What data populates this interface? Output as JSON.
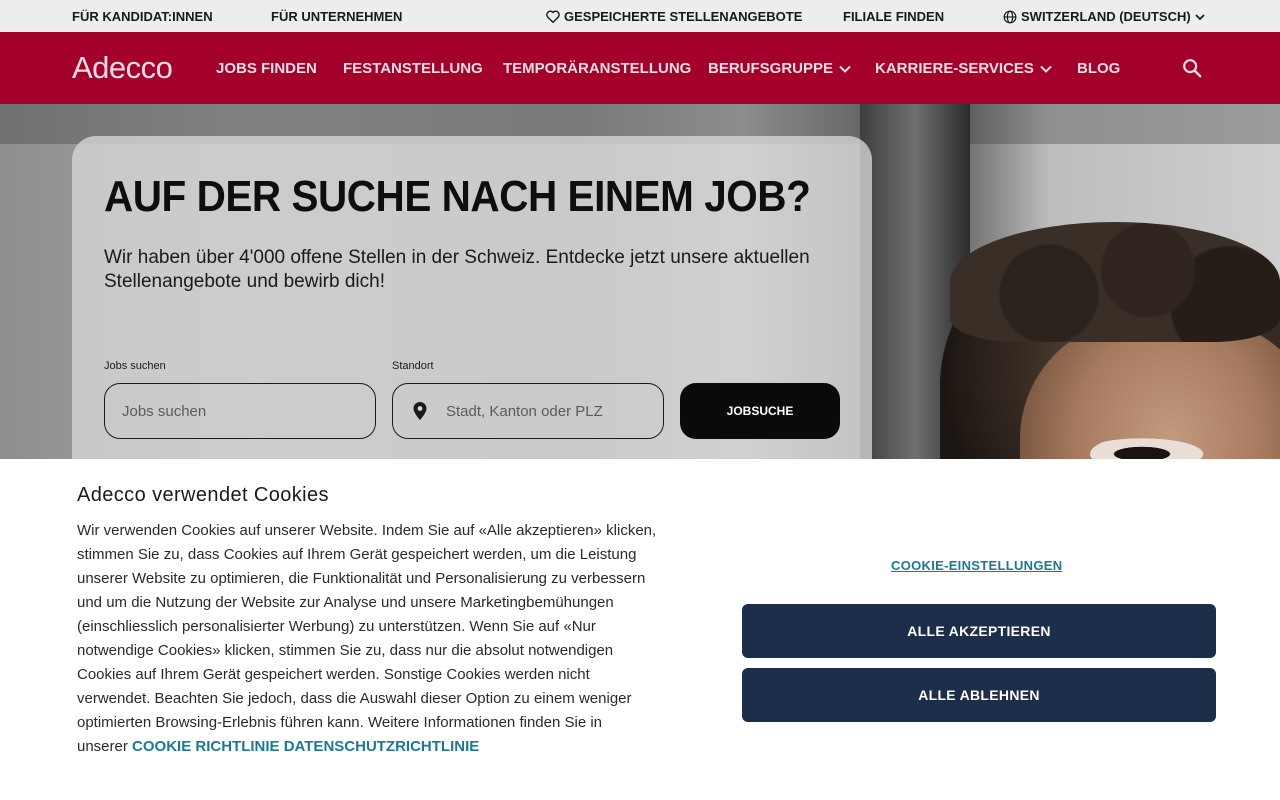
{
  "utility_bar": {
    "candidates": "FÜR KANDIDAT:INNEN",
    "companies": "FÜR UNTERNEHMEN",
    "saved_jobs": "GESPEICHERTE STELLENANGEBOTE",
    "find_branch": "FILIALE FINDEN",
    "region": "SWITZERLAND (DEUTSCH)"
  },
  "nav": {
    "logo": "Adecco",
    "items": [
      {
        "label": "JOBS FINDEN"
      },
      {
        "label": "FESTANSTELLUNG"
      },
      {
        "label": "TEMPORÄRANSTELLUNG"
      },
      {
        "label": "BERUFSGRUPPE"
      },
      {
        "label": "KARRIERE-SERVICES"
      },
      {
        "label": "BLOG"
      }
    ],
    "search_icon": "search-icon"
  },
  "hero": {
    "title": "AUF DER SUCHE NACH EINEM JOB?",
    "subtitle": "Wir haben über 4'000 offene Stellen in der Schweiz. Entdecke jetzt unsere aktuellen Stellenangebote und bewirb dich!",
    "jobs_label": "Jobs suchen",
    "jobs_placeholder": "Jobs suchen",
    "location_label": "Standort",
    "location_placeholder": "Stadt, Kanton oder PLZ",
    "search_button": "JOBSUCHE"
  },
  "cookie": {
    "title": "Adecco verwendet Cookies",
    "body": "Wir verwenden Cookies auf unserer Website. Indem Sie auf «Alle akzeptieren» klicken, stimmen Sie zu, dass Cookies auf Ihrem Gerät gespeichert werden, um die Leistung unserer Website zu optimieren, die Funktionalität und Personalisierung zu verbessern und um die Nutzung der Website zur Analyse und unsere Marketingbemühungen (einschliesslich personalisierter Werbung) zu unterstützen. Wenn Sie auf «Nur notwendige Cookies» klicken, stimmen Sie zu, dass nur die absolut notwendigen Cookies auf Ihrem Gerät gespeichert werden. Sonstige Cookies werden nicht verwendet. Beachten Sie jedoch, dass die Auswahl dieser Option zu einem weniger optimierten Browsing-Erlebnis führen kann. Weitere Informationen finden Sie in unserer",
    "policy_link": "COOKIE RICHTLINIE",
    "privacy_link": "DATENSCHUTZRICHTLINIE",
    "settings": "COOKIE-EINSTELLUNGEN",
    "accept_all": "ALLE AKZEPTIEREN",
    "reject_all": "ALLE ABLEHNEN"
  },
  "colors": {
    "brand": "#a3002c",
    "cookie_button": "#1c2e4a",
    "link": "#1a7a95"
  }
}
